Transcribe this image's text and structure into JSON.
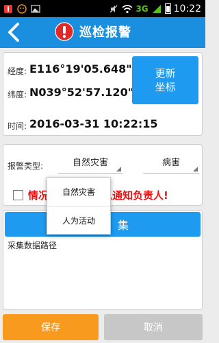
{
  "status_bar": {
    "network": "3G",
    "time": "10:22",
    "icons": [
      "notification-icon",
      "stop-icon",
      "image-icon",
      "mute-icon",
      "wifi-icon",
      "signal-icon",
      "battery-icon"
    ]
  },
  "header": {
    "title": "巡检报警",
    "bg_color": "#1a8fe0",
    "icons": [
      "back-arrow-icon",
      "alert-icon"
    ]
  },
  "location": {
    "longitude_label": "经度:",
    "longitude_value": "E116°19'05.648\"",
    "latitude_label": "纬度:",
    "latitude_value": "N039°52'57.120\"",
    "time_label": "时间:",
    "time_value": "2016-03-31 10:22:15",
    "update_button": "更新坐标"
  },
  "alarm": {
    "type_label": "报警类型:",
    "type_selected": "自然灾害",
    "subtype_selected": "病害",
    "notice_visible_left": "情况",
    "notice_visible_right": "息通知负责人!"
  },
  "collect": {
    "button_label": "集",
    "path_label": "采集数据路径"
  },
  "footer": {
    "save_label": "保存",
    "cancel_label": "取消",
    "save_color": "#f79a1e",
    "cancel_color": "#c7c7c7"
  },
  "dropdown": {
    "options": [
      "自然灾害",
      "人为活动"
    ]
  }
}
